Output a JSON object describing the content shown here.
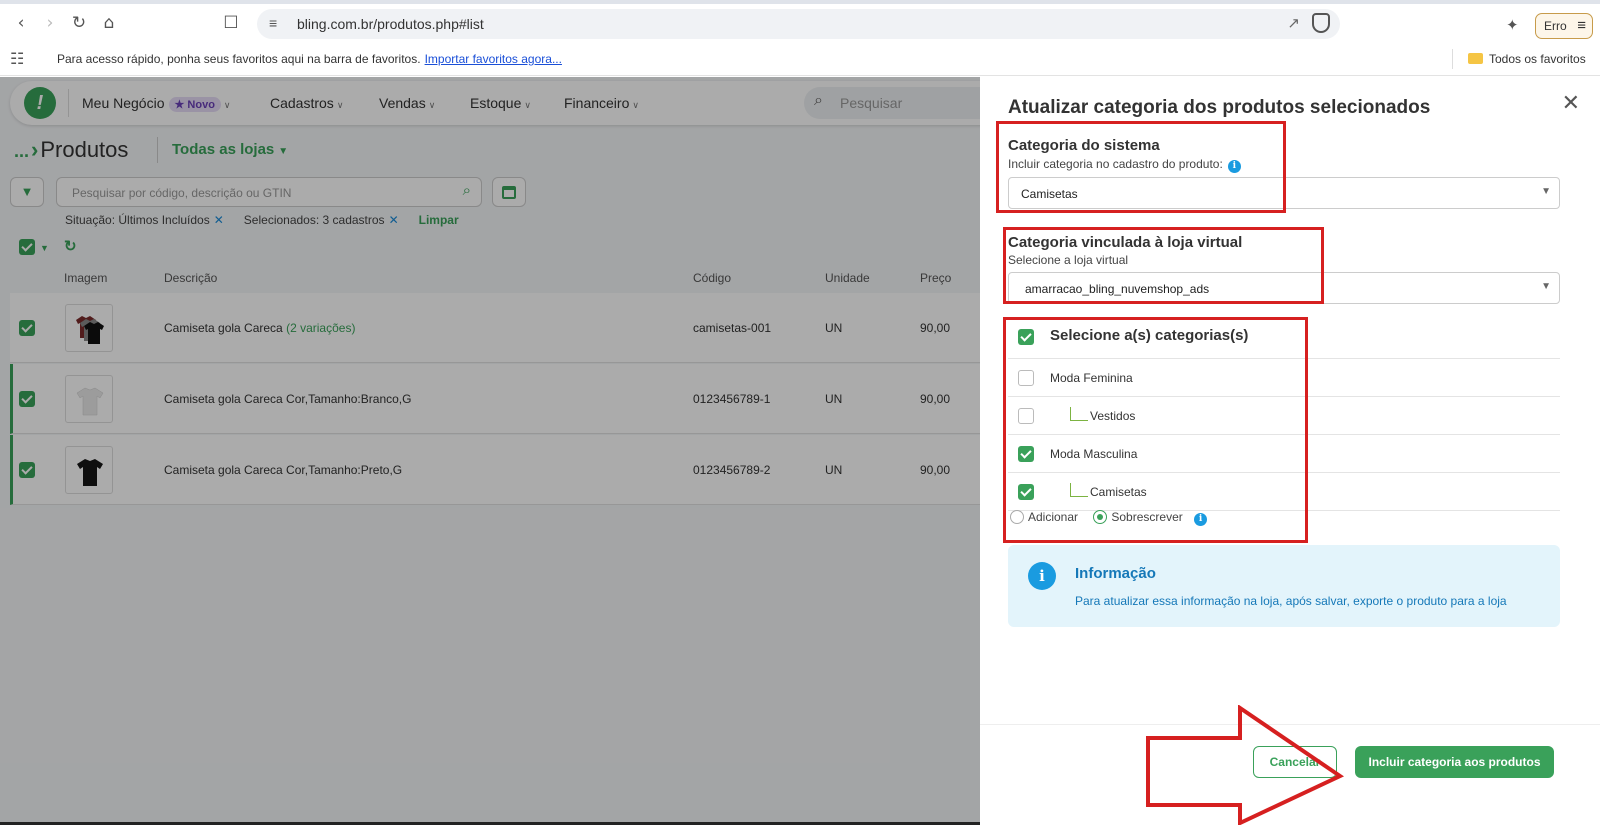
{
  "browser": {
    "url": "bling.com.br/produtos.php#list",
    "error_label": "Erro",
    "bookmarks_text": "Para acesso rápido, ponha seus favoritos aqui na barra de favoritos.",
    "bookmarks_link": "Importar favoritos agora...",
    "all_bookmarks": "Todos os favoritos"
  },
  "nav": {
    "items": [
      {
        "label": "Meu Negócio"
      },
      {
        "label": "Cadastros"
      },
      {
        "label": "Vendas"
      },
      {
        "label": "Estoque"
      },
      {
        "label": "Financeiro"
      }
    ],
    "badge": "★ Novo",
    "search_placeholder": "Pesquisar"
  },
  "page": {
    "breadcrumb_dots": "...",
    "title": "Produtos",
    "store_selector": "Todas as lojas",
    "search_placeholder": "Pesquisar por código, descrição ou GTIN",
    "chips": [
      "Situação: Últimos Incluídos",
      "Selecionados: 3 cadastros"
    ],
    "clear_label": "Limpar"
  },
  "table": {
    "headers": [
      "Imagem",
      "Descrição",
      "Código",
      "Unidade",
      "Preço"
    ],
    "rows": [
      {
        "description": "Camiseta gola Careca",
        "variations": "(2 variações)",
        "code": "camisetas-001",
        "unit": "UN",
        "price": "90,00",
        "checked": true
      },
      {
        "description": "Camiseta gola Careca Cor,Tamanho:Branco,G",
        "variations": "",
        "code": "0123456789-1",
        "unit": "UN",
        "price": "90,00",
        "checked": true
      },
      {
        "description": "Camiseta gola Careca Cor,Tamanho:Preto,G",
        "variations": "",
        "code": "0123456789-2",
        "unit": "UN",
        "price": "90,00",
        "checked": true
      }
    ]
  },
  "panel": {
    "title": "Atualizar categoria dos produtos selecionados",
    "system_category": {
      "title": "Categoria do sistema",
      "subtitle": "Incluir categoria no cadastro do produto:",
      "value": "Camisetas"
    },
    "store_category": {
      "title": "Categoria vinculada à loja virtual",
      "subtitle": "Selecione a loja virtual",
      "value": "amarracao_bling_nuvemshop_ads"
    },
    "categories_header": "Selecione a(s) categorias(s)",
    "categories": [
      {
        "label": "Moda Feminina",
        "checked": false,
        "child": false
      },
      {
        "label": "Vestidos",
        "checked": false,
        "child": true
      },
      {
        "label": "Moda Masculina",
        "checked": true,
        "child": false
      },
      {
        "label": "Camisetas",
        "checked": true,
        "child": true
      }
    ],
    "mode_add": "Adicionar",
    "mode_overwrite": "Sobrescrever",
    "info_title": "Informação",
    "info_message": "Para atualizar essa informação na loja, após salvar, exporte o produto para a loja",
    "cancel_label": "Cancelar",
    "submit_label": "Incluir categoria aos produtos"
  },
  "colors": {
    "brand_green": "#3aa15a",
    "info_blue": "#1a9be0",
    "annotation_red": "#d62020"
  }
}
